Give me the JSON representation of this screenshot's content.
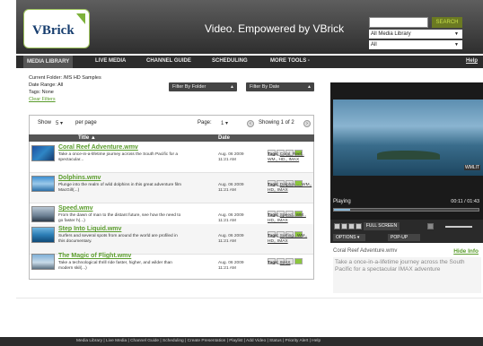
{
  "header": {
    "logo_text": "VBrick",
    "tagline": "Video. Empowered by VBrick",
    "search_button": "SEARCH",
    "search_placeholder": "",
    "library_select": "All Media Library",
    "filter_select": "All"
  },
  "nav": {
    "items": [
      "MEDIA LIBRARY",
      "LIVE MEDIA",
      "CHANNEL GUIDE",
      "SCHEDULING",
      "MORE TOOLS -"
    ],
    "help": "Help"
  },
  "info": {
    "current_folder": "Current Folder: /MS HD Samples",
    "date_range": "Date Range: All",
    "tags": "Tags: None",
    "clear_filters": "Clear Filters",
    "filter_folder": "Filter By Folder",
    "filter_date": "Filter By Date"
  },
  "list": {
    "show_label": "Show",
    "show_value": "5",
    "per_page": "per page",
    "page_label": "Page:",
    "page_value": "1",
    "showing": "Showing 1 of 2",
    "col_title": "Title",
    "col_date": "Date",
    "tags_label": "Tags:",
    "rows": [
      {
        "title": "Coral Reef Adventure.wmv",
        "desc": "Take a once-in-a-lifetime journey across the South Pacific for a spectacular...",
        "date": "Aug. 06 2009",
        "time": "11:21 AM",
        "tags": "Coral, Reef,, WM,, HD,, IMAX"
      },
      {
        "title": "Dolphins.wmv",
        "desc": "Plunge into the realm of wild dolphins in this great adventure film MacGill(...)",
        "date": "Aug. 06 2009",
        "time": "11:21 AM",
        "tags": "Dolphin,..., WM,, HD,, IMAX"
      },
      {
        "title": "Speed.wmv",
        "desc": "From the dawn of man to the distant future, see how the need to go faster h(...)",
        "date": "Aug. 06 2009",
        "time": "11:21 AM",
        "tags": "Speed,, WM,, HD,, IMAX"
      },
      {
        "title": "Step Into Liquid.wmv",
        "desc": "Surfers and several spots from around the world are profiled in this documentary.",
        "date": "Aug. 06 2009",
        "time": "11:21 AM",
        "tags": "Surfing,, WM,, HD,, IMAX"
      },
      {
        "title": "The Magic of Flight.wmv",
        "desc": "Take a technological thrill ride faster, higher, and wilder than modern skil(...)",
        "date": "Aug. 06 2009",
        "time": "11:21 AM",
        "tags": "IMAX"
      }
    ]
  },
  "player": {
    "watermark": "WMLIT",
    "status": "Playing",
    "time": "00:11 / 01:43",
    "full_screen": "FULL SCREEN",
    "options": "OPTIONS",
    "popup": "POP-UP",
    "now_playing": "Coral Reef Adventure.wmv",
    "hide_info": "Hide Info",
    "description": "Take a once-in-a-lifetime journey across the South Pacific for a spectacular IMAX adventure",
    "progress": 0.11
  },
  "footer": "Media Library | Live Media | Channel Guide | Scheduling | Create Presentation | Playlist | Add Video | Status | Priority Alert | Help"
}
